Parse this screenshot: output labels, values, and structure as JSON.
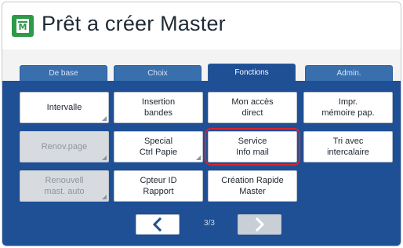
{
  "header": {
    "title": "Prêt a créer Master",
    "icon": "master-status-icon",
    "icon_glyph": "M",
    "icon_color": "#2d9a48"
  },
  "tabs": [
    {
      "label": "De base",
      "active": false
    },
    {
      "label": "Choix",
      "active": false
    },
    {
      "label": "Fonctions",
      "active": true
    },
    {
      "label": "Admin.",
      "active": false
    }
  ],
  "buttons": {
    "intervalle": {
      "label": "Intervalle",
      "enabled": true
    },
    "insertion_bandes": {
      "label": "Insertion\nbandes",
      "enabled": true
    },
    "mon_acces_direct": {
      "label": "Mon accès\ndirect",
      "enabled": true
    },
    "impr_memoire": {
      "label": "Impr.\nmémoire pap.",
      "enabled": true
    },
    "renov_page": {
      "label": "Renov.page",
      "enabled": false
    },
    "special_ctrl": {
      "label": "Special\nCtrl Papie",
      "enabled": true
    },
    "service_info_mail": {
      "label": "Service\nInfo mail",
      "enabled": true,
      "highlighted": true
    },
    "tri_avec": {
      "label": "Tri avec\nintercalaire",
      "enabled": true
    },
    "renouvell": {
      "label": "Renouvell\nmast. auto",
      "enabled": false
    },
    "cpteur_id": {
      "label": "Cpteur ID\nRapport",
      "enabled": true
    },
    "creation_rapide": {
      "label": "Création Rapide\nMaster",
      "enabled": true
    }
  },
  "pager": {
    "page": "3/3",
    "prev_icon": "chevron-left-icon",
    "next_icon": "chevron-right-icon"
  },
  "colors": {
    "panel": "#1f4f95",
    "highlight": "#d9232b",
    "accent_arrow": "#1f4f95"
  }
}
